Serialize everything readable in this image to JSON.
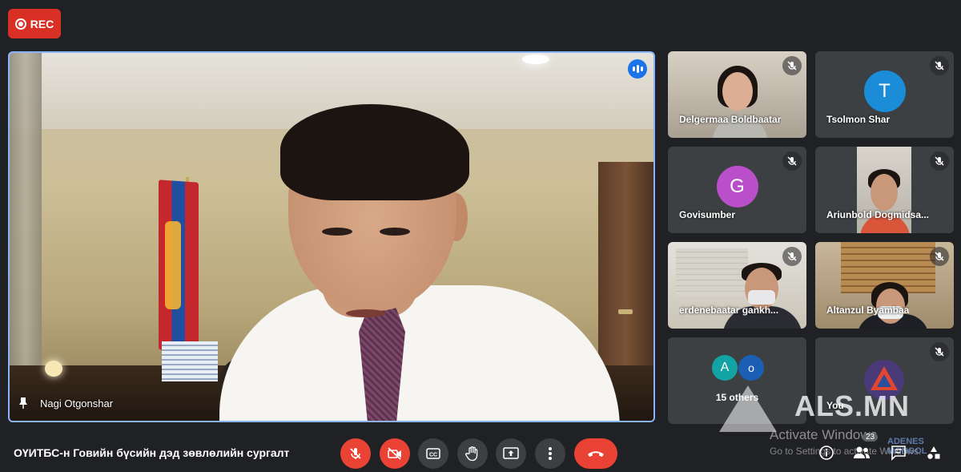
{
  "recording": {
    "label": "REC"
  },
  "main_speaker": {
    "name": "Nagi Otgonshar"
  },
  "participants": [
    {
      "name": "Delgermaa Boldbaatar",
      "type": "video"
    },
    {
      "name": "Tsolmon Shar",
      "type": "avatar",
      "initial": "T",
      "color": "#1a8cd8"
    },
    {
      "name": "Govisumber",
      "type": "avatar",
      "initial": "G",
      "color": "#b94fc9"
    },
    {
      "name": "Ariunbold Dogmidsa...",
      "type": "video"
    },
    {
      "name": "erdenebaatar gankh...",
      "type": "video"
    },
    {
      "name": "Altanzul Byambaa",
      "type": "video"
    },
    {
      "name": "15 others",
      "type": "others",
      "initials": [
        "A",
        "o"
      ],
      "colors": [
        "#12a4a4",
        "#1a5fb4"
      ]
    },
    {
      "name": "You",
      "type": "self"
    }
  ],
  "meeting": {
    "title": "ОҮИТБС-н Говийн бүсийн дэд зөвлөлийн сургалт"
  },
  "people_count": "23",
  "watermark": {
    "brand": "ALS.MN",
    "activate": "Activate Windows",
    "settings": "Go to Settings to activate Windows.",
    "mongol_line1": "ADENES",
    "mongol_line2": "MONGOL"
  },
  "colors": {
    "background": "#202124",
    "tile": "#3c4043",
    "danger": "#ea4335",
    "speaking_blue": "#1a73e8",
    "active_border": "#8ab4f8"
  }
}
